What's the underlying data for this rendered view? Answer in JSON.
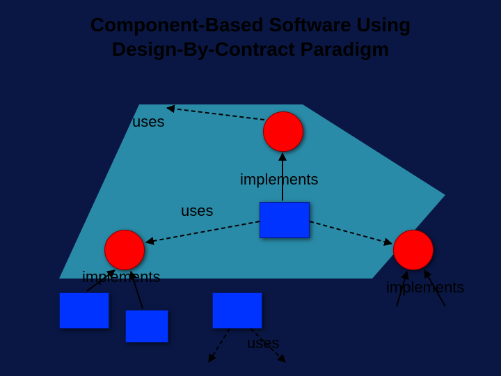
{
  "title": "Component-Based Software Using\nDesign-By-Contract Paradigm",
  "labels": {
    "uses_top": "uses",
    "implements_top": "implements",
    "uses_mid": "uses",
    "implements_left": "implements",
    "implements_right": "implements",
    "uses_bottom": "uses"
  },
  "colors": {
    "background": "#0a1744",
    "polygon_fill": "#1e90b0",
    "circle": "#ff0000",
    "box": "#0033ff"
  }
}
